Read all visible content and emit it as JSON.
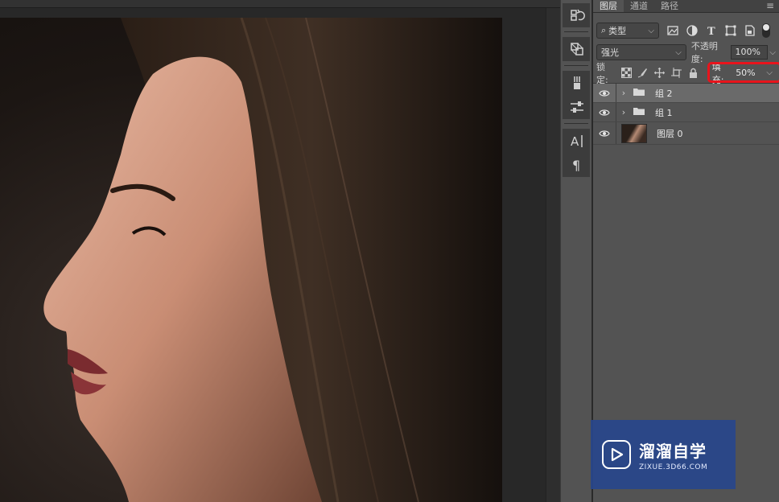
{
  "tabs": [
    {
      "label": "图层",
      "active": true
    },
    {
      "label": "通道",
      "active": false
    },
    {
      "label": "路径",
      "active": false
    }
  ],
  "panel_menu_icon": "hamburger-menu-icon",
  "filter": {
    "kind_label": "类型",
    "icons": [
      "image-filter-icon",
      "adjustment-filter-icon",
      "type-filter-icon",
      "shape-filter-icon",
      "smart-object-filter-icon"
    ]
  },
  "blend": {
    "mode": "强光",
    "opacity_label": "不透明度:",
    "opacity_value": "100%"
  },
  "lock": {
    "label": "锁定:",
    "fill_label": "填充:",
    "fill_value": "50%",
    "highlight_color": "#e8141c"
  },
  "layers": [
    {
      "name": "组 2",
      "type": "group",
      "visible": true,
      "selected": true
    },
    {
      "name": "组 1",
      "type": "group",
      "visible": true,
      "selected": false
    },
    {
      "name": "图层 0",
      "type": "pixel",
      "visible": true,
      "selected": false
    }
  ],
  "tools": [
    "history-icon",
    "3d-icon",
    "brush-settings-icon",
    "properties-icon",
    "character-icon",
    "paragraph-icon"
  ],
  "watermark": {
    "title": "溜溜自学",
    "subtitle": "ZIXUE.3D66.COM",
    "bg_color": "#284688"
  }
}
